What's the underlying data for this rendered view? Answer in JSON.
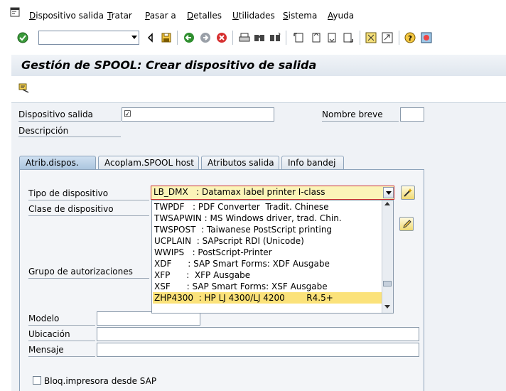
{
  "menubar": {
    "items": [
      "Dispositivo salida",
      "Tratar",
      "Pasar a",
      "Detalles",
      "Utilidades",
      "Sistema",
      "Ayuda"
    ],
    "underline": [
      "D",
      "T",
      "P",
      "D",
      "U",
      "S",
      "A"
    ]
  },
  "toolbar": {
    "command_value": "",
    "icons": [
      "check-icon",
      "back-icon",
      "save-icon",
      "green-back-icon",
      "exit-icon",
      "cancel-icon",
      "print-icon",
      "find-icon",
      "find-next-icon",
      "first-page-icon",
      "prev-page-icon",
      "next-page-icon",
      "last-page-icon",
      "create-session-icon",
      "shortcut-icon",
      "help-icon",
      "layout-icon"
    ]
  },
  "page": {
    "title": "Gestión de SPOOL: Crear dispositivo de salida"
  },
  "form": {
    "dispositivo_label": "Dispositivo salida",
    "dispositivo_value": "☑",
    "nombre_breve_label": "Nombre breve",
    "descripcion_label": "Descripción"
  },
  "tabs": [
    {
      "label": "Atrib.dispos.",
      "active": true
    },
    {
      "label": "Acoplam.SPOOL host",
      "active": false
    },
    {
      "label": "Atributos salida",
      "active": false
    },
    {
      "label": "Info bandej",
      "active": false
    }
  ],
  "panel": {
    "tipo_label": "Tipo de dispositivo",
    "clase_label": "Clase de dispositivo",
    "grupo_label": "Grupo de autorizaciones",
    "modelo_label": "Modelo",
    "ubicacion_label": "Ubicación",
    "mensaje_label": "Mensaje",
    "bloq_label": "Bloq.impresora desde SAP"
  },
  "combo": {
    "value": "LB_DMX   : Datamax label printer I-class"
  },
  "dropdown": {
    "options": [
      "TWPDF   : PDF Converter  Tradit. Chinese",
      "TWSAPWIN : MS Windows driver, trad. Chin.",
      "TWSPOST  : Taiwanese PostScript printing",
      "UCPLAIN  : SAPscript RDI (Unicode)",
      "WWIPS   : PostScript-Printer",
      "XDF      : SAP Smart Forms: XDF Ausgabe",
      "XFP      :  XFP Ausgabe",
      "XSF      : SAP Smart Forms: XSF Ausgabe",
      "ZHP4300  : HP LJ 4300/LJ 4200        R4.5+"
    ],
    "selected_index": 8
  },
  "colors": {
    "combo_bg": "#fbf4b8",
    "selected_bg": "#fbe27a",
    "form_bg": "#eff2f6"
  }
}
